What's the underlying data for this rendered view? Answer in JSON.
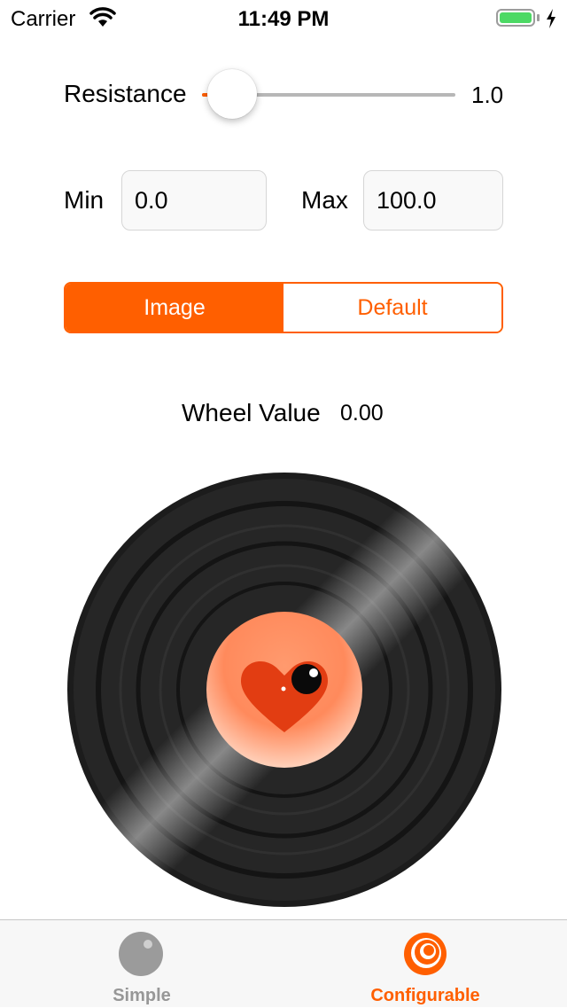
{
  "status_bar": {
    "carrier": "Carrier",
    "time": "11:49 PM",
    "icons": [
      "wifi-icon",
      "battery-icon",
      "charging-bolt-icon"
    ],
    "battery_color": "#4cd964"
  },
  "resistance": {
    "label": "Resistance",
    "value_text": "1.0",
    "slider_level": 0.0
  },
  "range": {
    "min_label": "Min",
    "min_value": "0.0",
    "max_label": "Max",
    "max_value": "100.0"
  },
  "segmented": {
    "options": [
      "Image",
      "Default"
    ],
    "selected": "Image"
  },
  "wheel": {
    "label": "Wheel Value",
    "value": "0.00",
    "image": "vinyl-record-heart-icon"
  },
  "tabbar": {
    "items": [
      {
        "label": "Simple",
        "icon": "ball-icon",
        "selected": false
      },
      {
        "label": "Configurable",
        "icon": "spiral-icon",
        "selected": true
      }
    ]
  },
  "colors": {
    "accent": "#ff5f00",
    "inactive_tab": "#979797"
  }
}
